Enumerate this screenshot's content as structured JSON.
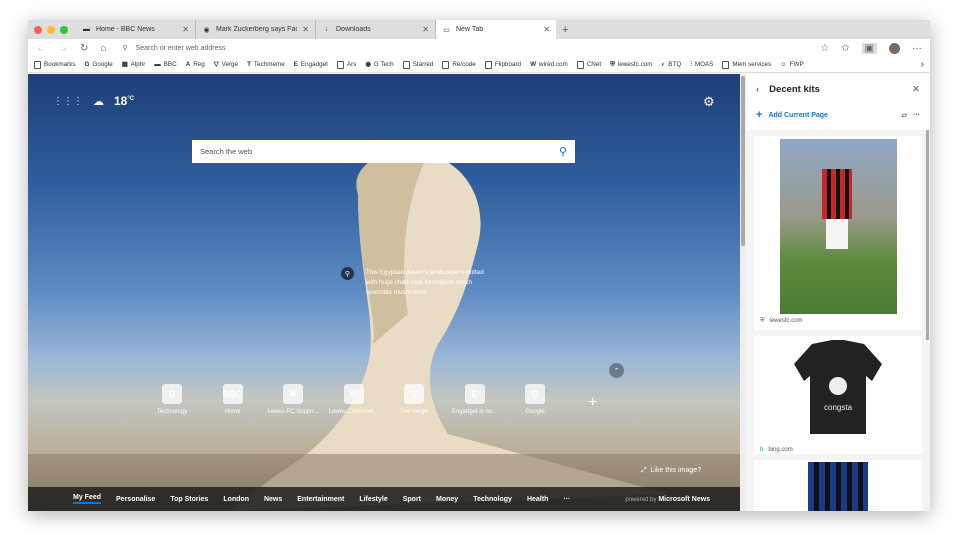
{
  "tabs": [
    {
      "label": "Home - BBC News",
      "icon": "bbc-icon"
    },
    {
      "label": "Mark Zuckerberg says Facebo",
      "icon": "guardian-icon"
    },
    {
      "label": "Downloads",
      "icon": "download-icon"
    },
    {
      "label": "New Tab",
      "icon": "newtab-icon",
      "active": true
    }
  ],
  "address": {
    "placeholder": "Search or enter web address"
  },
  "bookmarks": [
    "Bookmarks",
    "Google",
    "Alphr",
    "BBC",
    "Reg",
    "Verge",
    "Techmeme",
    "Engadget",
    "Ars",
    "G Tech",
    "Starred",
    "Re/code",
    "Flipboard",
    "wired.com",
    "CNet",
    "lewesfc.com",
    "BTQ",
    "MOAS",
    "Mem services",
    "FWP"
  ],
  "weather": {
    "temp": "18",
    "unit": "°C"
  },
  "search": {
    "placeholder": "Search the web"
  },
  "image_caption": "This Egyptian desert's landscape is dotted with huge chalk rock formations which resemble mushrooms",
  "tiles": [
    {
      "label": "Technology",
      "glyph": "G"
    },
    {
      "label": "Home",
      "glyph": "BBC"
    },
    {
      "label": "Lewes FC Suppo...",
      "glyph": "⛨"
    },
    {
      "label": "Lewes Communi...",
      "glyph": "⛨"
    },
    {
      "label": "The Verge",
      "glyph": "▽"
    },
    {
      "label": "Engadget is no...",
      "glyph": "E"
    },
    {
      "label": "Google",
      "glyph": "G"
    }
  ],
  "like_image": "Like this image?",
  "feed": {
    "items": [
      "My Feed",
      "Personalise",
      "Top Stories",
      "London",
      "News",
      "Entertainment",
      "Lifestyle",
      "Sport",
      "Money",
      "Technology",
      "Health",
      "···"
    ],
    "powered_by": "powered by",
    "brand": "Microsoft News"
  },
  "sidebar": {
    "title": "Decent kits",
    "add_label": "Add Current Page",
    "cards": [
      {
        "source": "lewesfc.com"
      },
      {
        "source": "bing.com"
      }
    ]
  },
  "colors": {
    "accent": "#0a78d7"
  }
}
